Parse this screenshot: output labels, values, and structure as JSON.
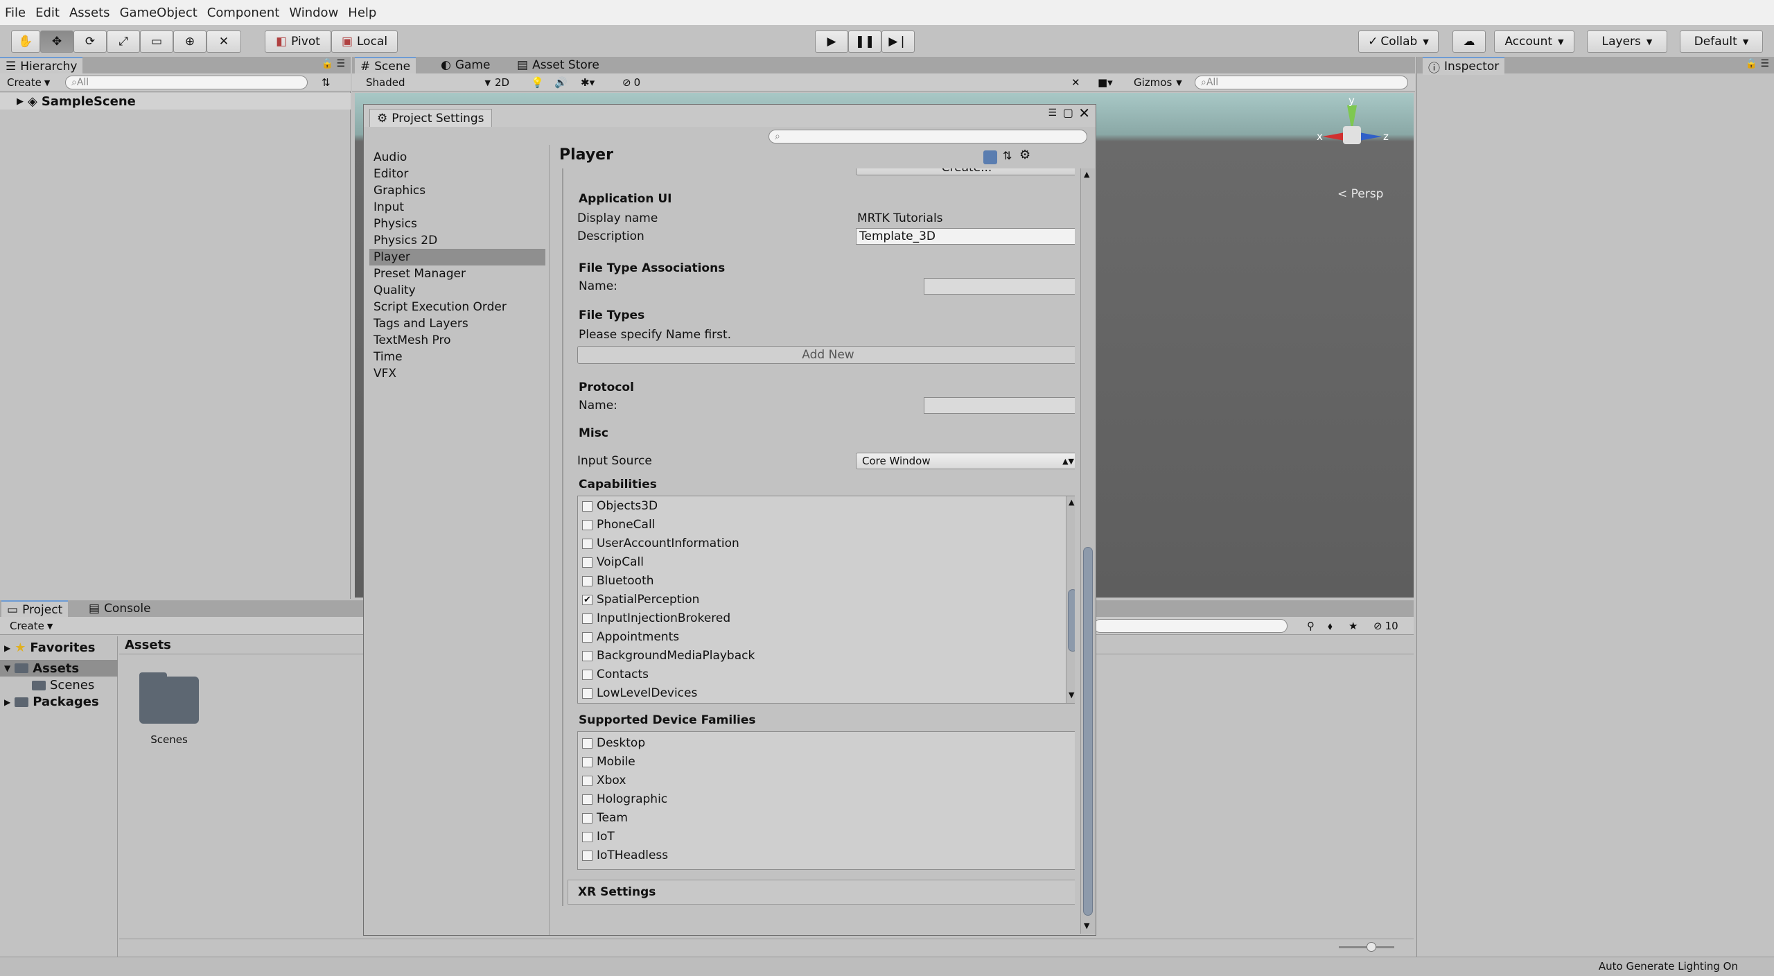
{
  "menu": [
    "File",
    "Edit",
    "Assets",
    "GameObject",
    "Component",
    "Window",
    "Help"
  ],
  "toolbar": {
    "pivot": "Pivot",
    "local": "Local",
    "collab": "Collab",
    "account": "Account",
    "layers": "Layers",
    "layout": "Default"
  },
  "hierarchy": {
    "tab": "Hierarchy",
    "create": "Create",
    "search_placeholder": "All",
    "scene": "SampleScene"
  },
  "scene": {
    "tabs": [
      "Scene",
      "Game",
      "Asset Store"
    ],
    "shading": "Shaded",
    "mode2d": "2D",
    "hidden_count": "0",
    "gizmos": "Gizmos",
    "search_placeholder": "All",
    "persp": "Persp",
    "axis_x": "x",
    "axis_y": "y",
    "axis_z": "z"
  },
  "inspector": {
    "tab": "Inspector"
  },
  "project": {
    "tabs": [
      "Project",
      "Console"
    ],
    "create": "Create",
    "favorites": "Favorites",
    "assets": "Assets",
    "scenes": "Scenes",
    "packages": "Packages",
    "breadcrumb": "Assets",
    "folder_label": "Scenes",
    "hidden_count": "10"
  },
  "project_settings": {
    "title": "Project Settings",
    "search_placeholder": "",
    "sidebar": [
      "Audio",
      "Editor",
      "Graphics",
      "Input",
      "Physics",
      "Physics 2D",
      "Player",
      "Preset Manager",
      "Quality",
      "Script Execution Order",
      "Tags and Layers",
      "TextMesh Pro",
      "Time",
      "VFX"
    ],
    "selected": "Player",
    "header": "Player",
    "create_button": "Create...",
    "application_ui": {
      "header": "Application UI",
      "display_name_label": "Display name",
      "display_name_value": "MRTK Tutorials",
      "description_label": "Description",
      "description_value": "Template_3D"
    },
    "file_type_assoc": {
      "header": "File Type Associations",
      "name_label": "Name:"
    },
    "file_types": {
      "header": "File Types",
      "note": "Please specify Name first.",
      "add_new": "Add New"
    },
    "protocol": {
      "header": "Protocol",
      "name_label": "Name:"
    },
    "misc": {
      "header": "Misc",
      "input_source_label": "Input Source",
      "input_source_value": "Core Window"
    },
    "capabilities": {
      "header": "Capabilities",
      "items": [
        {
          "label": "Objects3D",
          "checked": false
        },
        {
          "label": "PhoneCall",
          "checked": false
        },
        {
          "label": "UserAccountInformation",
          "checked": false
        },
        {
          "label": "VoipCall",
          "checked": false
        },
        {
          "label": "Bluetooth",
          "checked": false
        },
        {
          "label": "SpatialPerception",
          "checked": true
        },
        {
          "label": "InputInjectionBrokered",
          "checked": false
        },
        {
          "label": "Appointments",
          "checked": false
        },
        {
          "label": "BackgroundMediaPlayback",
          "checked": false
        },
        {
          "label": "Contacts",
          "checked": false
        },
        {
          "label": "LowLevelDevices",
          "checked": false
        }
      ]
    },
    "device_families": {
      "header": "Supported Device Families",
      "items": [
        {
          "label": "Desktop",
          "checked": false
        },
        {
          "label": "Mobile",
          "checked": false
        },
        {
          "label": "Xbox",
          "checked": false
        },
        {
          "label": "Holographic",
          "checked": false
        },
        {
          "label": "Team",
          "checked": false
        },
        {
          "label": "IoT",
          "checked": false
        },
        {
          "label": "IoTHeadless",
          "checked": false
        }
      ]
    },
    "xr_settings": "XR Settings"
  },
  "status": {
    "text": "Auto Generate Lighting On"
  }
}
